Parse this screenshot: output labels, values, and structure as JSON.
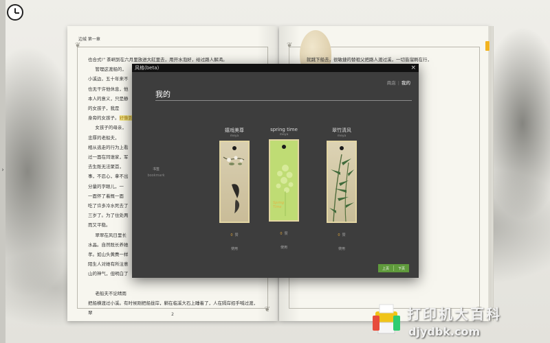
{
  "book": {
    "chapter_label": "边城 第一章",
    "page_number": "2",
    "left_text": "也合式!\" 茶峒到在六月里放进大缸里去，用开水泡好，给过路人解渴。\n     管理这渡船的，\n小溪边，五十年来不\n也无干许他休息，他\n本人的意义，只是静\n的女孩子，我是\n身旁的女孩子。\n     女孩子的母亲，\n忠厚的老船夫，\n相从逃走的行为上看\n过一面在同谁家，军\n去生既无法聚首，\n事，不忍心，拿不出\n分量的字眼儿，一\n一面怀了着慨一面\n吃了许多冷水死去了\n三岁了。为了住处两\n而又平稳。\n     翠翠在风日里长\n水晶。自然既长养她\n孝。如山头黄麂一样\n陌生人对她有所注意\n山的神气，但明白了\n\n     老船夫不论晴雨\n把船横渡过小溪。有时候刚把船拢岸，躺在临溪大石上睡着了，人在隔岸招手喊过渡，翠",
    "right_text": "就跳下船去，很敏捷的替祖父把路人渡过溪，一切皆溜刷在行，\n                                          最先一跃而上，\n                                          在门前大岩石上晒太\n                                          上，把木头向\n                                          。祖父见\n                                          过，就\n                                          过渡人来了，\n                                          船开动时，于是\n                                          。\n                                          在溶静空气里，溪\n\n                                          花轿，翠翠必争着\n                                          花轿上去，那个\n                                          把船靠近路的岸\n                                          在头上，\n\n                                          一杆酒时，祖父\n                                          把船靠近岸\n                                          祖父身边，\n                                          ，这时船只可",
    "highlight": "好像到了。"
  },
  "dialog": {
    "title": "风格(beta)",
    "close_label": "×",
    "tabs": [
      "商店",
      "我的"
    ],
    "heading": "我的",
    "side": {
      "label": "书签",
      "sub": "bookmark"
    },
    "bookmarks": [
      {
        "name": "嬉戏美尊",
        "author": "meya",
        "likes": "0",
        "likes_unit": "赞",
        "use_label": "使用"
      },
      {
        "name": "spring time",
        "author": "meya",
        "likes": "0",
        "likes_unit": "赞",
        "use_label": "使用",
        "inner_text": "Spring\nTime"
      },
      {
        "name": "翠竹清风",
        "author": "meya",
        "likes": "0",
        "likes_unit": "赞",
        "use_label": "使用"
      }
    ],
    "pager": {
      "prev": "上页",
      "next": "下页"
    }
  },
  "watermark": {
    "title": "打印机大百科",
    "url": "djydbk.com"
  },
  "colors": {
    "dialog_bg": "#3d3d3d",
    "pager_green": "#5f9a3c",
    "highlight": "#f1e58a",
    "bookmark_tab": "#f2b31f"
  }
}
